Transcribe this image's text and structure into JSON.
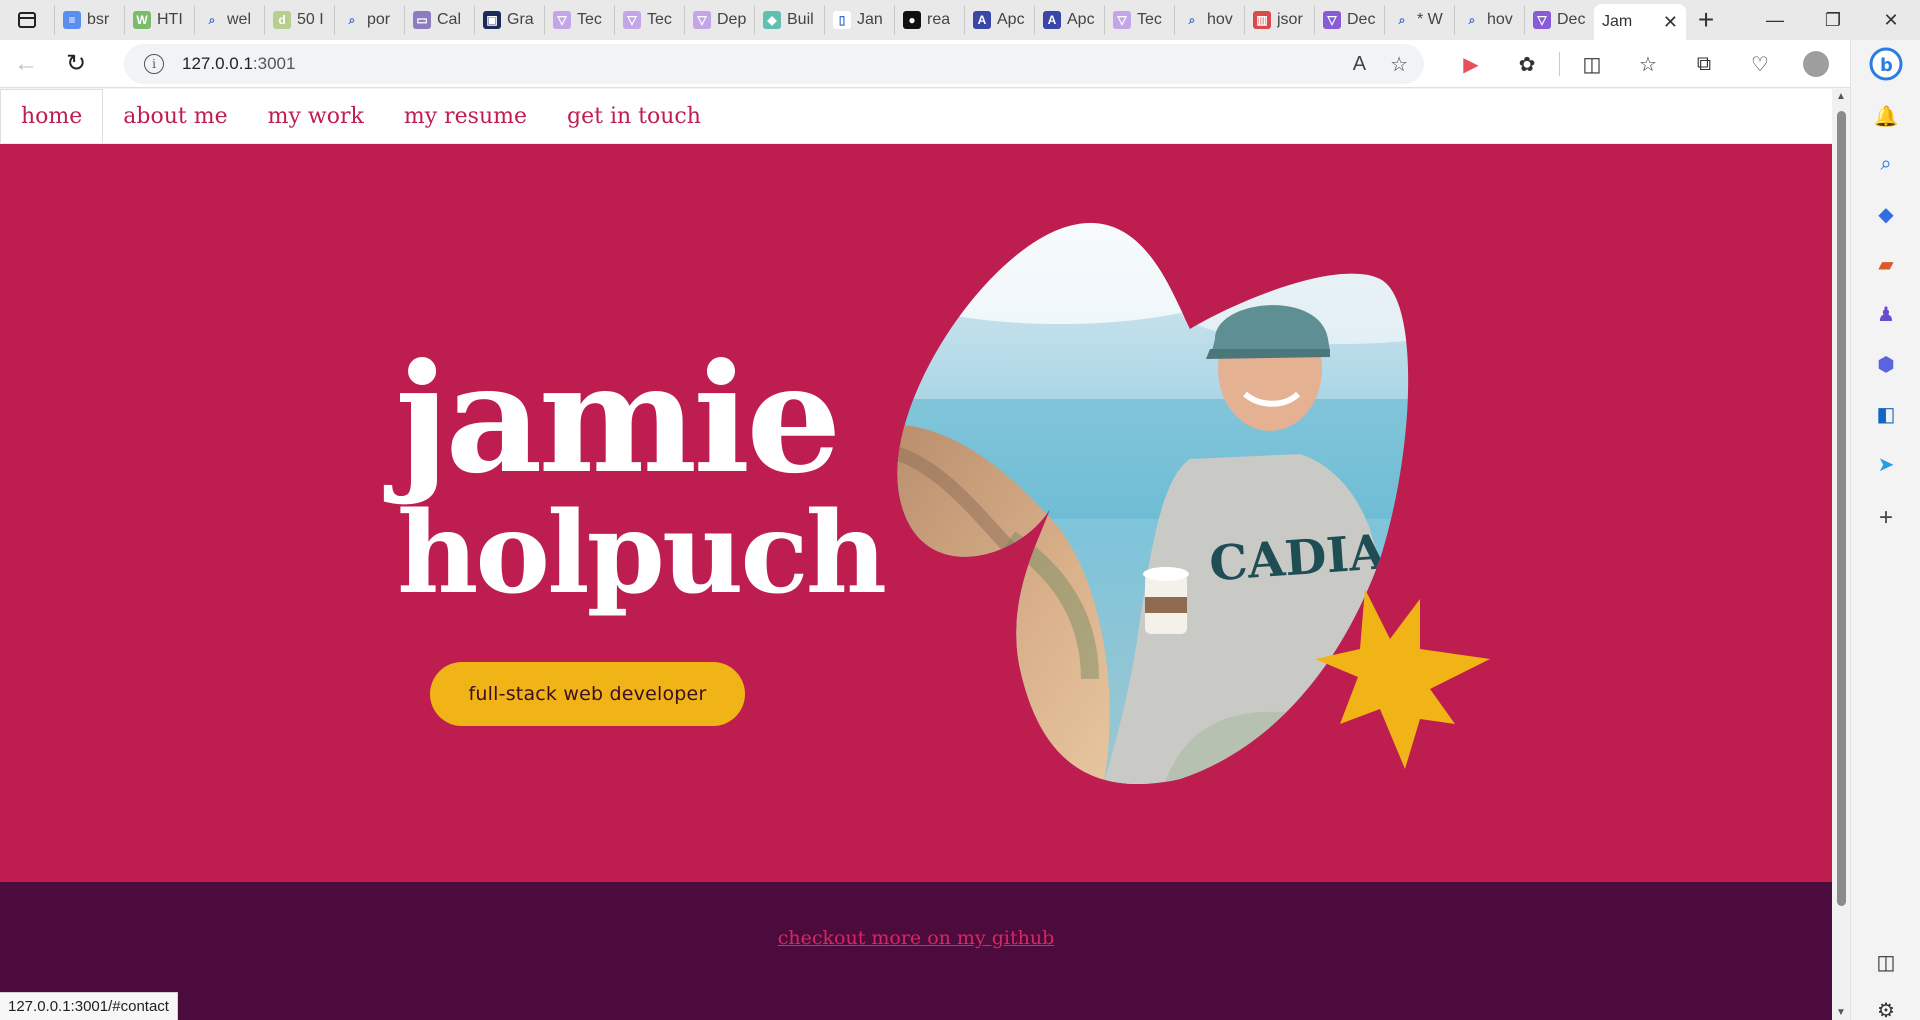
{
  "browser": {
    "tabs": [
      {
        "label": "bsr",
        "fav_color": "#5b8def",
        "fav_glyph": "≡"
      },
      {
        "label": "HTI",
        "fav_color": "#7cbb6b",
        "fav_glyph": "W"
      },
      {
        "label": "wel",
        "fav_color": "#e9e9e9",
        "fav_glyph": "⌕"
      },
      {
        "label": "50 I",
        "fav_color": "#b6cf8f",
        "fav_glyph": "d"
      },
      {
        "label": "por",
        "fav_color": "#e9e9e9",
        "fav_glyph": "⌕"
      },
      {
        "label": "Cal",
        "fav_color": "#8e7cc3",
        "fav_glyph": "▭"
      },
      {
        "label": "Gra",
        "fav_color": "#1c2b5c",
        "fav_glyph": "▣"
      },
      {
        "label": "Tec",
        "fav_color": "#c3a6e8",
        "fav_glyph": "▽"
      },
      {
        "label": "Tec",
        "fav_color": "#c3a6e8",
        "fav_glyph": "▽"
      },
      {
        "label": "Dep",
        "fav_color": "#c3a6e8",
        "fav_glyph": "▽"
      },
      {
        "label": "Buil",
        "fav_color": "#5fbfb0",
        "fav_glyph": "◆"
      },
      {
        "label": "Jan",
        "fav_color": "#ffffff",
        "fav_glyph": "▯"
      },
      {
        "label": "rea",
        "fav_color": "#111111",
        "fav_glyph": "●"
      },
      {
        "label": "Apc",
        "fav_color": "#3a47a8",
        "fav_glyph": "A"
      },
      {
        "label": "Apc",
        "fav_color": "#3a47a8",
        "fav_glyph": "A"
      },
      {
        "label": "Tec",
        "fav_color": "#c3a6e8",
        "fav_glyph": "▽"
      },
      {
        "label": "hov",
        "fav_color": "#e9e9e9",
        "fav_glyph": "⌕"
      },
      {
        "label": "jsor",
        "fav_color": "#d94a4a",
        "fav_glyph": "▥"
      },
      {
        "label": "Dec",
        "fav_color": "#8a5bd6",
        "fav_glyph": "▽"
      },
      {
        "label": "* W",
        "fav_color": "#e9e9e9",
        "fav_glyph": "⌕"
      },
      {
        "label": "hov",
        "fav_color": "#e9e9e9",
        "fav_glyph": "⌕"
      },
      {
        "label": "Dec",
        "fav_color": "#8a5bd6",
        "fav_glyph": "▽"
      }
    ],
    "active_tab": {
      "label": "Jam",
      "close": "✕"
    },
    "new_tab": "+",
    "window_controls": {
      "minimize": "—",
      "restore": "❐",
      "close": "✕"
    },
    "url_host": "127.0.0.1",
    "url_port": ":3001",
    "back": "←",
    "reload": "↻",
    "info_glyph": "i",
    "read_aloud": "A",
    "favorite": "☆",
    "toolbar_icons": [
      "▶",
      "✿",
      "◫",
      "☆",
      "⧉",
      "♡",
      "●",
      "⋯"
    ],
    "status_url": "127.0.0.1:3001/#contact"
  },
  "site": {
    "nav": [
      {
        "label": "home",
        "active": true
      },
      {
        "label": "about me",
        "active": false
      },
      {
        "label": "my work",
        "active": false
      },
      {
        "label": "my resume",
        "active": false
      },
      {
        "label": "get in touch",
        "active": false
      }
    ],
    "first_name": "jamie",
    "last_name": "holpuch",
    "role": "full-stack web developer",
    "footer_link": "checkout more on my github",
    "colors": {
      "primary": "#bd1e4f",
      "accent": "#f0b417",
      "footer_bg": "#4b0c3d",
      "footer_link": "#d92660"
    }
  },
  "edge_sidebar": {
    "icons": [
      "bing-icon",
      "bell-icon",
      "search-icon",
      "tag-icon",
      "briefcase-icon",
      "games-icon",
      "office-icon",
      "outlook-icon",
      "send-icon",
      "add-icon",
      "sidebar-toggle-icon",
      "settings-icon"
    ]
  }
}
